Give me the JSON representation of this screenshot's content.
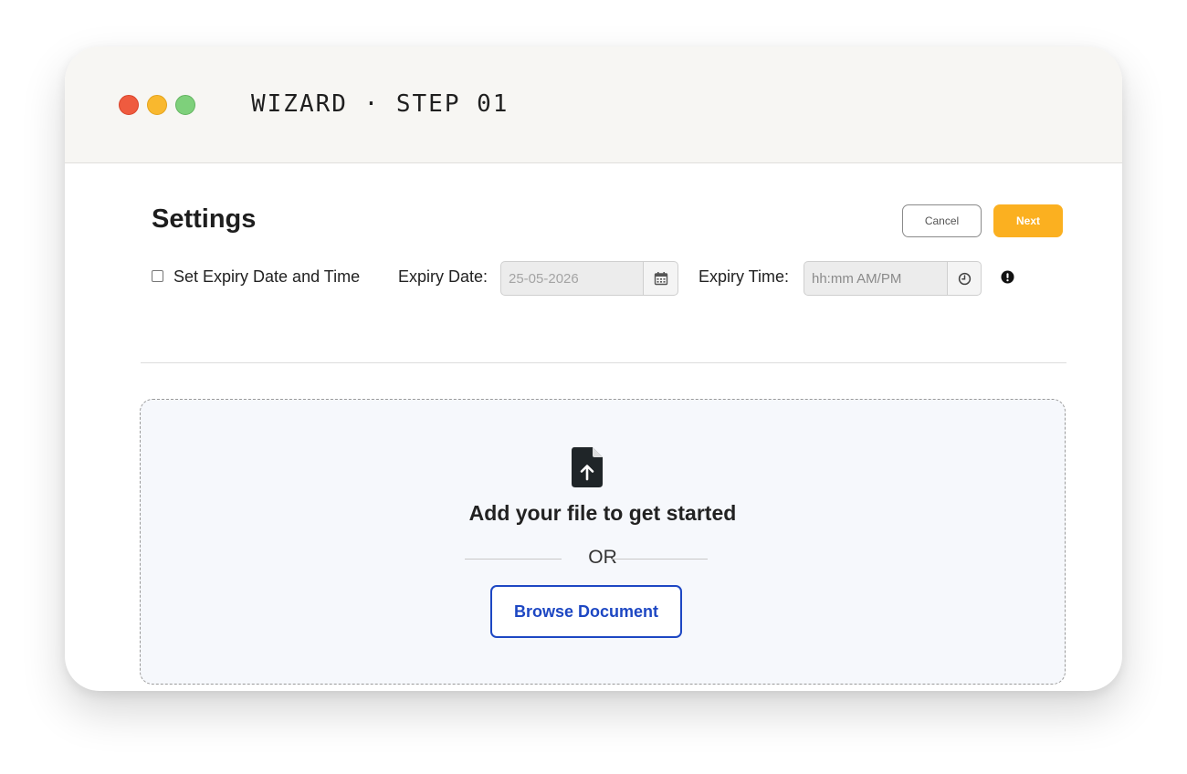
{
  "window": {
    "title": "WIZARD · STEP 01",
    "controls": [
      "close",
      "minimize",
      "maximize"
    ]
  },
  "header": {
    "title": "Settings",
    "cancel_label": "Cancel",
    "next_label": "Next"
  },
  "expiry": {
    "checkbox_label": "Set Expiry Date and Time",
    "checked": false,
    "date_label": "Expiry Date:",
    "date_value": "25-05-2026",
    "date_icon": "calendar-icon",
    "time_label": "Expiry Time:",
    "time_placeholder": "hh:mm AM/PM",
    "time_icon": "clock-icon",
    "info_icon": "exclamation-circle-icon"
  },
  "upload": {
    "icon": "file-upload-icon",
    "title": "Add your file to get started",
    "or_text": "OR",
    "browse_label": "Browse Document"
  },
  "colors": {
    "accent": "#fbb020",
    "link": "#1d47c3",
    "traffic_red": "#ef5b3f",
    "traffic_yellow": "#f9b82e",
    "traffic_green": "#7ed07b"
  }
}
